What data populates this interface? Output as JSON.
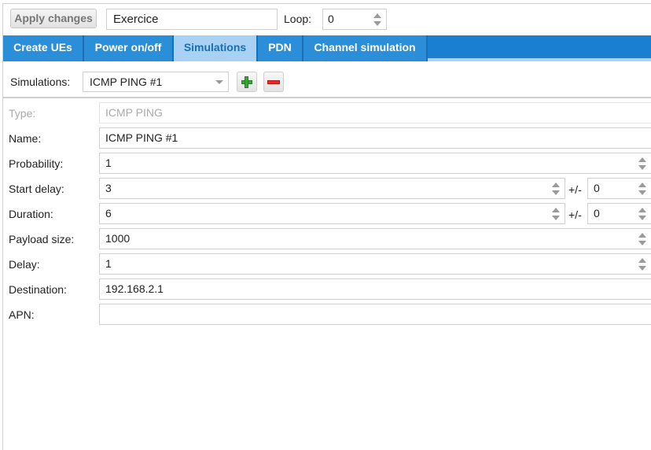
{
  "toolbar": {
    "apply_label": "Apply changes",
    "name_value": "Exercice",
    "loop_label": "Loop:",
    "loop_value": "0"
  },
  "tabs": [
    {
      "label": "Create UEs",
      "active": false
    },
    {
      "label": "Power on/off",
      "active": false
    },
    {
      "label": "Simulations",
      "active": true
    },
    {
      "label": "PDN",
      "active": false
    },
    {
      "label": "Channel simulation",
      "active": false
    }
  ],
  "simulations": {
    "label": "Simulations:",
    "selected": "ICMP PING #1"
  },
  "form": {
    "type_label": "Type:",
    "type_value": "ICMP PING",
    "name_label": "Name:",
    "name_value": "ICMP PING #1",
    "probability_label": "Probability:",
    "probability_value": "1",
    "start_delay_label": "Start delay:",
    "start_delay_value": "3",
    "start_delay_pm_label": "+/-",
    "start_delay_pm_value": "0",
    "duration_label": "Duration:",
    "duration_value": "6",
    "duration_pm_label": "+/-",
    "duration_pm_value": "0",
    "payload_label": "Payload size:",
    "payload_value": "1000",
    "delay_label": "Delay:",
    "delay_value": "1",
    "destination_label": "Destination:",
    "destination_value": "192.168.2.1",
    "apn_label": "APN:",
    "apn_value": ""
  },
  "colors": {
    "tab_bar": "#1a7fd1",
    "tab_active": "#a9d1f3",
    "add_icon": "#3aa63a",
    "remove_icon": "#e52b2b"
  },
  "icons": [
    "plus-icon",
    "minus-icon",
    "chevron-down-icon",
    "spinner-icon"
  ]
}
